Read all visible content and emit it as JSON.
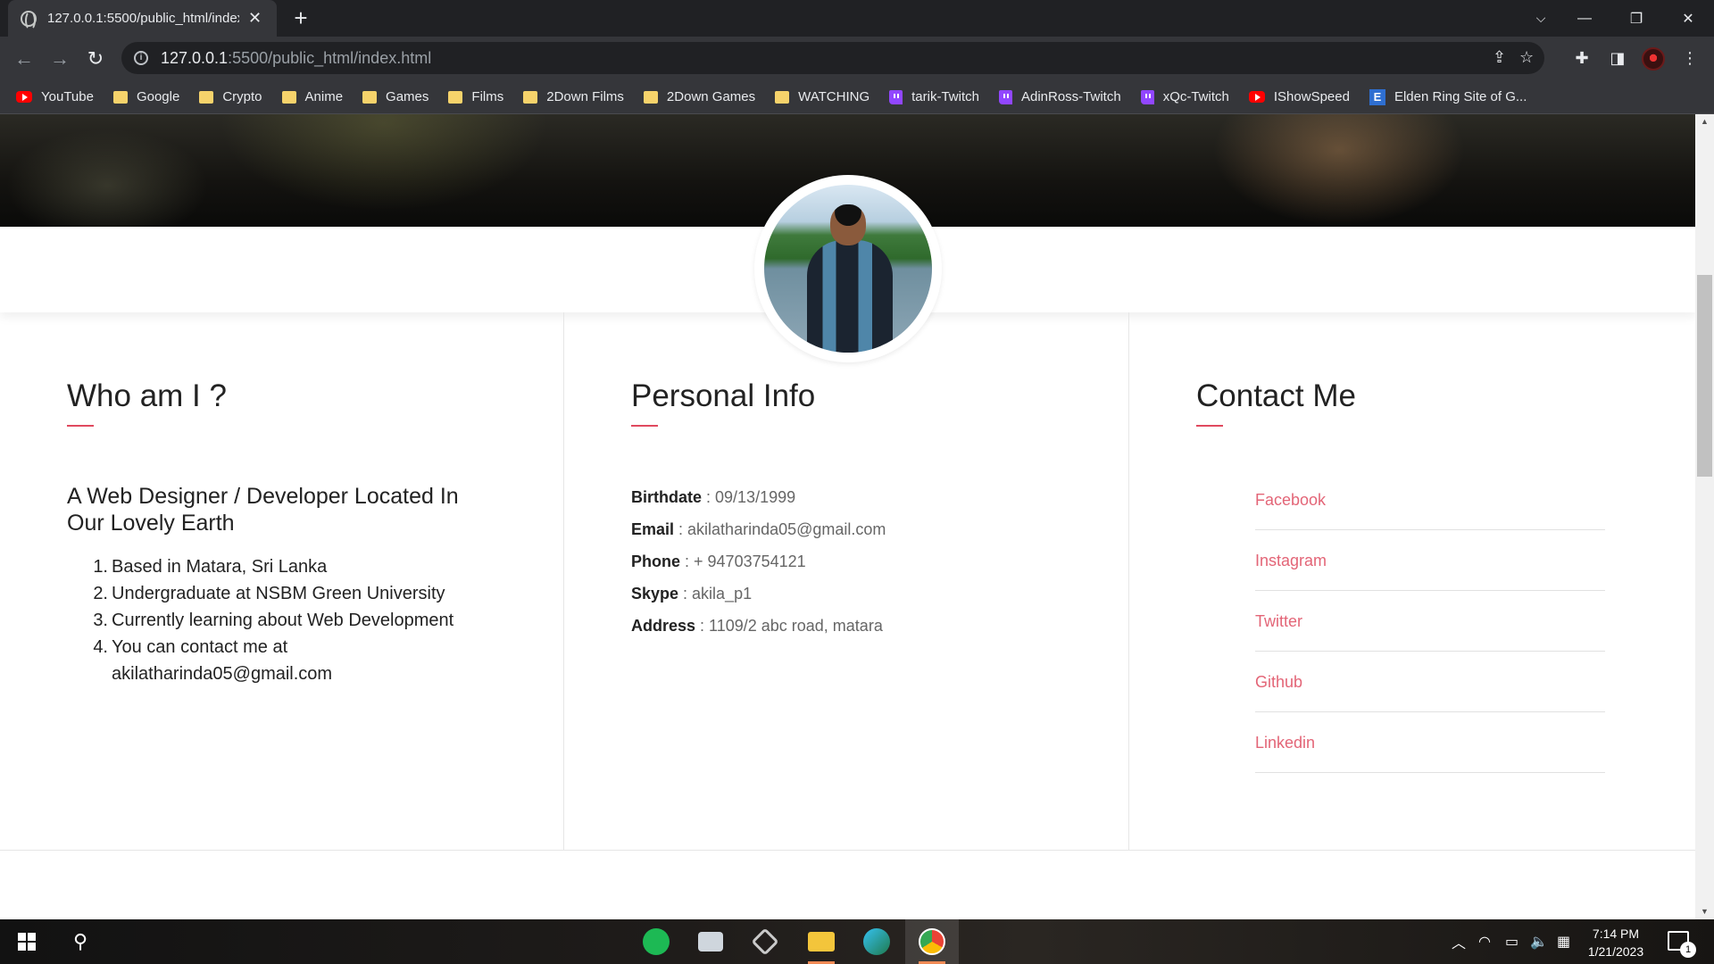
{
  "browser": {
    "tab_title": "127.0.0.1:5500/public_html/index.html",
    "url_host": "127.0.0.1",
    "url_rest": ":5500/public_html/index.html",
    "bookmarks": [
      {
        "label": "YouTube",
        "icon": "youtube-icon"
      },
      {
        "label": "Google",
        "icon": "folder-icon"
      },
      {
        "label": "Crypto",
        "icon": "folder-icon"
      },
      {
        "label": "Anime",
        "icon": "folder-icon"
      },
      {
        "label": "Games",
        "icon": "folder-icon"
      },
      {
        "label": "Films",
        "icon": "folder-icon"
      },
      {
        "label": "2Down Films",
        "icon": "folder-icon"
      },
      {
        "label": "2Down Games",
        "icon": "folder-icon"
      },
      {
        "label": "WATCHING",
        "icon": "folder-icon"
      },
      {
        "label": "tarik-Twitch",
        "icon": "twitch-icon"
      },
      {
        "label": "AdinRoss-Twitch",
        "icon": "twitch-icon"
      },
      {
        "label": "xQc-Twitch",
        "icon": "twitch-icon"
      },
      {
        "label": "IShowSpeed",
        "icon": "youtube-icon"
      },
      {
        "label": "Elden Ring Site of G...",
        "icon": "elden-ring-icon"
      }
    ]
  },
  "about": {
    "heading": "Who am I ?",
    "tagline": "A Web Designer / Developer Located In Our Lovely Earth",
    "facts": [
      {
        "num": "1.",
        "text": "Based in Matara, Sri Lanka"
      },
      {
        "num": "2.",
        "text": "Undergraduate at NSBM Green University"
      },
      {
        "num": "3.",
        "text": "Currently learning about Web Development"
      },
      {
        "num": "4.",
        "text": "You can contact me at akilatharinda05@gmail.com"
      }
    ]
  },
  "personal": {
    "heading": "Personal Info",
    "rows": [
      {
        "label": "Birthdate",
        "value": " : 09/13/1999"
      },
      {
        "label": "Email",
        "value": " : akilatharinda05@gmail.com"
      },
      {
        "label": "Phone",
        "value": " : + 94703754121"
      },
      {
        "label": "Skype",
        "value": " : akila_p1"
      },
      {
        "label": "Address",
        "value": " : 1109/2 abc road, matara"
      }
    ]
  },
  "contact": {
    "heading": "Contact Me",
    "links": [
      "Facebook",
      "Instagram",
      "Twitter",
      "Github",
      "Linkedin"
    ]
  },
  "taskbar": {
    "time": "7:14 PM",
    "date": "1/21/2023",
    "notifications": "1"
  },
  "colors": {
    "accent": "#e04a5f",
    "link": "#e36577",
    "chrome_dark": "#202124",
    "chrome_toolbar": "#35363a"
  }
}
